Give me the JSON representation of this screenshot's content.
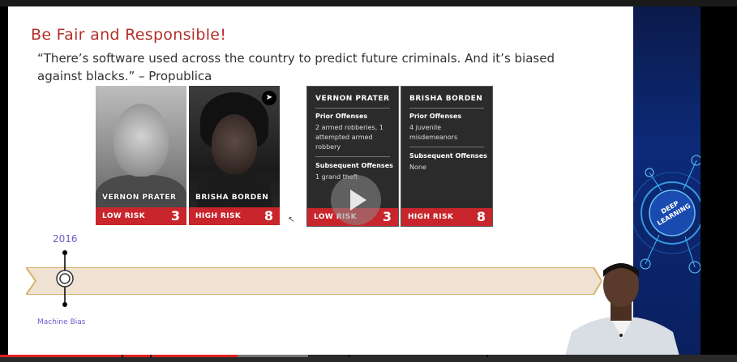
{
  "slide": {
    "title": "Be Fair and Responsible!",
    "quote": "“There’s software used across the country to predict future criminals. And it’s biased against blacks.” – Propublica"
  },
  "mugshots": [
    {
      "name": "VERNON PRATER",
      "risk_label": "LOW RISK",
      "risk_score": "3"
    },
    {
      "name": "BRISHA BORDEN",
      "risk_label": "HIGH RISK",
      "risk_score": "8"
    }
  ],
  "cards": [
    {
      "name": "VERNON PRATER",
      "prior_heading": "Prior Offenses",
      "prior_text": "2 armed robberies, 1 attempted armed robbery",
      "subsequent_heading": "Subsequent Offenses",
      "subsequent_text": "1 grand theft",
      "risk_label": "LOW RISK",
      "risk_score": "3"
    },
    {
      "name": "BRISHA BORDEN",
      "prior_heading": "Prior Offenses",
      "prior_text": "4 juvenile misdemeanors",
      "subsequent_heading": "Subsequent Offenses",
      "subsequent_text": "None",
      "risk_label": "HIGH RISK",
      "risk_score": "8"
    }
  ],
  "timeline": {
    "year": "2016",
    "label": "Machine Bias"
  },
  "deco": {
    "badge_line1": "DEEP",
    "badge_line2": "LEARNING"
  },
  "video": {
    "progress_fraction": 0.322,
    "buffered_fraction": 0.418
  },
  "colors": {
    "title_red": "#b3302a",
    "risk_red": "#c8252c",
    "timeline_purple": "#6a5acd",
    "arrow_fill": "#efe2d2",
    "arrow_border": "#d9b36a",
    "progress_red": "#e02020"
  },
  "icons": {
    "cursor": "pointer-cursor-icon",
    "play": "play-icon"
  }
}
